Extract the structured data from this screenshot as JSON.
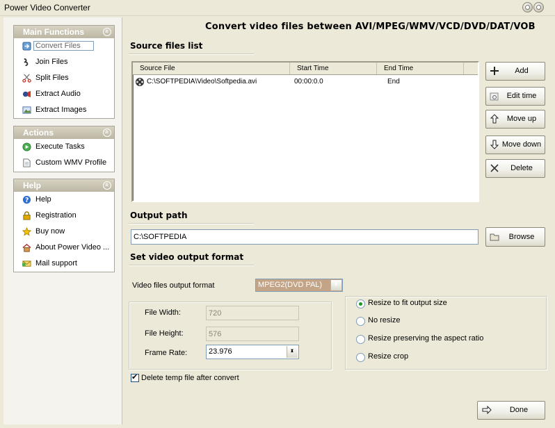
{
  "window": {
    "title": "Power Video Converter"
  },
  "sidebar": {
    "main_functions": {
      "title": "Main Functions",
      "items": [
        {
          "label": "Convert Files",
          "icon": "convert-icon"
        },
        {
          "label": "Join Files",
          "icon": "join-icon"
        },
        {
          "label": "Split Files",
          "icon": "scissors-icon"
        },
        {
          "label": "Extract Audio",
          "icon": "audio-icon"
        },
        {
          "label": "Extract Images",
          "icon": "image-icon"
        }
      ]
    },
    "actions": {
      "title": "Actions",
      "items": [
        {
          "label": "Execute Tasks",
          "icon": "execute-icon"
        },
        {
          "label": "Custom WMV Profile",
          "icon": "document-icon"
        }
      ]
    },
    "help": {
      "title": "Help",
      "items": [
        {
          "label": "Help",
          "icon": "help-icon"
        },
        {
          "label": "Registration",
          "icon": "lock-icon"
        },
        {
          "label": "Buy now",
          "icon": "star-icon"
        },
        {
          "label": "About Power Video ...",
          "icon": "home-icon"
        },
        {
          "label": "Mail support",
          "icon": "mail-icon"
        }
      ]
    }
  },
  "main": {
    "headline": "Convert video files between AVI/MPEG/WMV/VCD/DVD/DAT/VOB",
    "source_section": "Source files list",
    "columns": [
      "Source File",
      "Start Time",
      "End Time"
    ],
    "rows": [
      {
        "file": "C:\\SOFTPEDIA\\Video\\Softpedia.avi",
        "start": "00:00:0.0",
        "end": "End"
      }
    ],
    "buttons": {
      "add": "Add",
      "edit_time": "Edit time",
      "move_up": "Move up",
      "move_down": "Move down",
      "delete": "Delete",
      "browse": "Browse",
      "done": "Done"
    },
    "output_section": "Output path",
    "output_path": "C:\\SOFTPEDIA",
    "format_section": "Set video output format",
    "format_label": "Video files output format",
    "format_value": "MPEG2(DVD PAL)",
    "file_width_label": "File Width:",
    "file_width": "720",
    "file_height_label": "File Height:",
    "file_height": "576",
    "frame_rate_label": "Frame Rate:",
    "frame_rate": "23.976",
    "resize_options": [
      {
        "label": "Resize to fit output size",
        "selected": true
      },
      {
        "label": "No resize",
        "selected": false
      },
      {
        "label": "Resize preserving the aspect ratio",
        "selected": false
      },
      {
        "label": "Resize crop",
        "selected": false
      }
    ],
    "delete_temp_label": "Delete temp file after convert",
    "delete_temp_checked": true
  }
}
